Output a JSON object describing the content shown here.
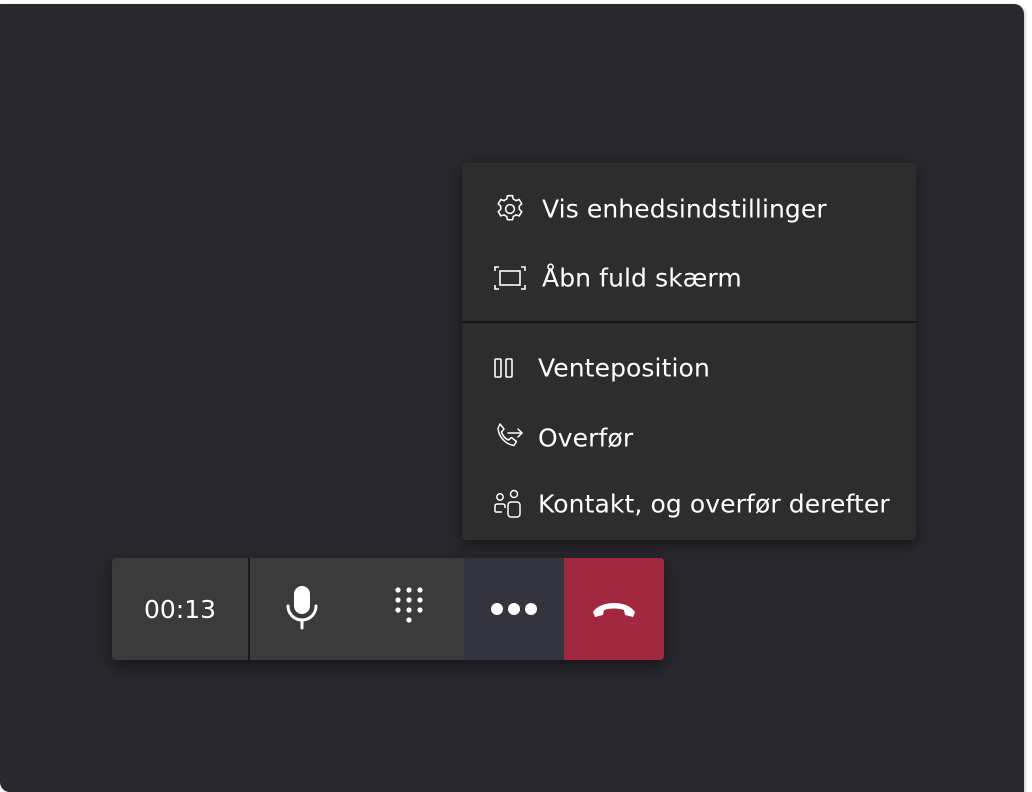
{
  "menu": {
    "items": [
      {
        "label": "Vis enhedsindstillinger",
        "icon": "gear-icon"
      },
      {
        "label": "Åbn fuld skærm",
        "icon": "fullscreen-icon"
      },
      {
        "label": "Venteposition",
        "icon": "pause-icon"
      },
      {
        "label": "Overfør",
        "icon": "transfer-call-icon"
      },
      {
        "label": "Kontakt, og overfør derefter",
        "icon": "consult-transfer-icon"
      }
    ]
  },
  "call_controls": {
    "timer": "00:13",
    "mic_icon": "microphone-icon",
    "dialpad_icon": "dialpad-icon",
    "more_icon": "more-options-icon",
    "hangup_icon": "hang-up-icon"
  },
  "colors": {
    "window_bg": "#28282e",
    "menu_bg": "#2d2d2d",
    "toolbar_bg": "#3b3b3b",
    "more_active_bg": "#34343f",
    "hangup_red": "#a1283e"
  }
}
